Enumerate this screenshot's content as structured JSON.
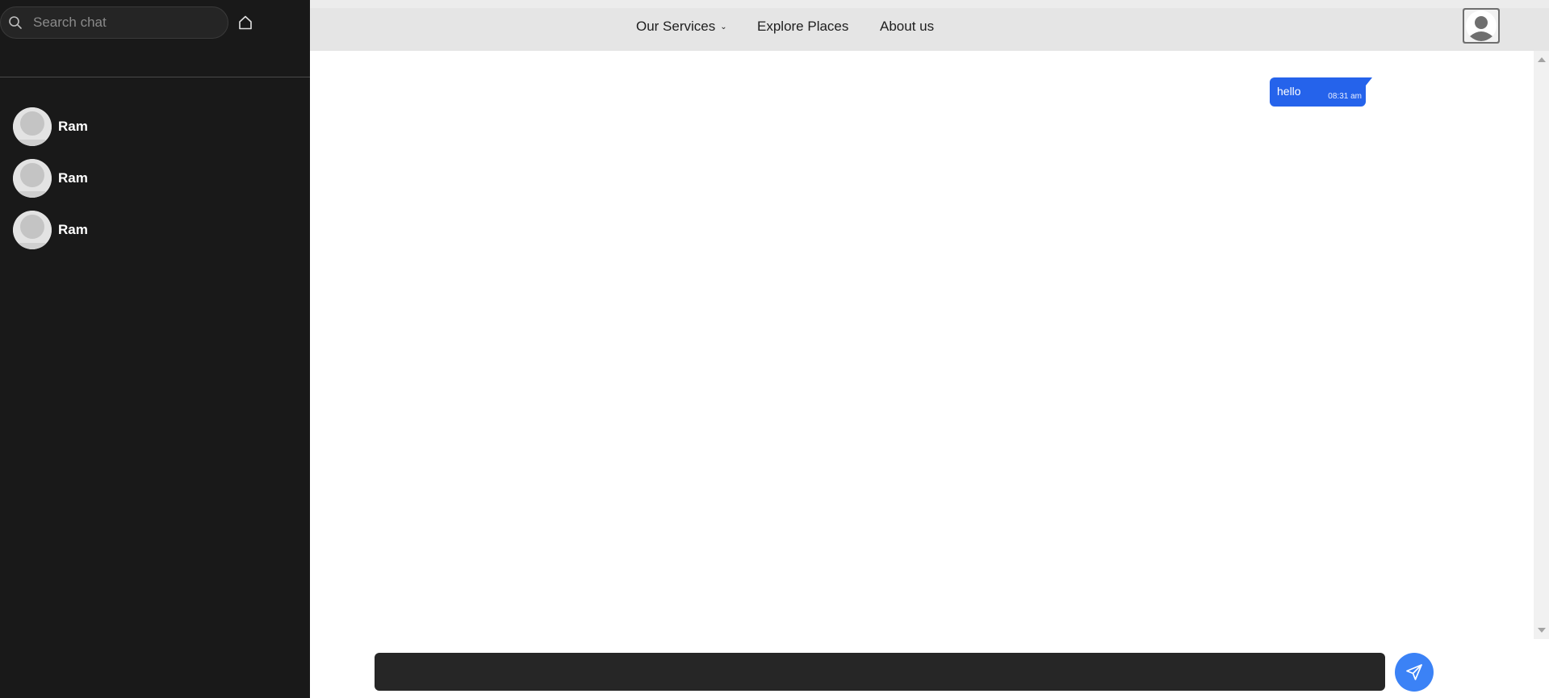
{
  "sidebar": {
    "search": {
      "placeholder": "Search chat",
      "value": ""
    },
    "home_icon": "home-icon",
    "chats": [
      {
        "name": "Ram",
        "avatar": "default-avatar"
      },
      {
        "name": "Ram",
        "avatar": "default-avatar"
      },
      {
        "name": "Ram",
        "avatar": "default-avatar"
      }
    ]
  },
  "nav": {
    "services_label": "Our Services",
    "services_chevron": "chevron-down-icon",
    "explore_label": "Explore Places",
    "about_label": "About us",
    "profile_icon": "user-avatar-icon"
  },
  "messages": [
    {
      "text": "hello",
      "time": "08:31 am",
      "direction": "outgoing"
    }
  ],
  "composer": {
    "placeholder": "",
    "value": "",
    "send_icon": "send-icon"
  },
  "colors": {
    "sidebar_bg": "#191919",
    "topbar_bg": "#e5e5e5",
    "bubble_bg": "#2563eb",
    "send_button": "#3b82f6",
    "composer_bg": "#262626"
  }
}
